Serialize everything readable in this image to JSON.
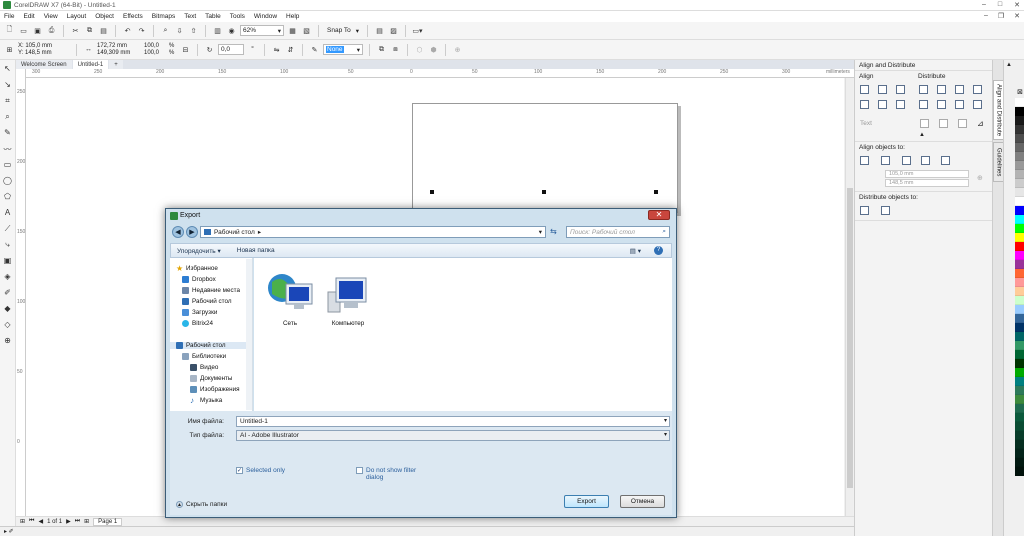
{
  "window": {
    "title": "CorelDRAW X7 (64-Bit) - Untitled-1",
    "min": "–",
    "max": "□",
    "close": "✕"
  },
  "menu": [
    "File",
    "Edit",
    "View",
    "Layout",
    "Object",
    "Effects",
    "Bitmaps",
    "Text",
    "Table",
    "Tools",
    "Window",
    "Help"
  ],
  "mdi_controls": {
    "min": "–",
    "restore": "❐",
    "close": "✕"
  },
  "toolbar1": {
    "zoom": "62%",
    "snap": "Snap To"
  },
  "toolbar2": {
    "x": "X: 105,0 mm",
    "y": "Y: 148,5 mm",
    "w": "172,72 mm",
    "h": "149,309 mm",
    "sx": "100,0",
    "sy": "100,0",
    "pct": "%",
    "angle": "0,0",
    "outline": "None"
  },
  "doc_tabs": [
    "Welcome Screen",
    "Untitled-1"
  ],
  "ruler": {
    "ticks": [
      "300",
      "250",
      "200",
      "150",
      "100",
      "50",
      "0",
      "50",
      "100",
      "150",
      "200",
      "250",
      "300",
      "350"
    ],
    "unit": "millimeters"
  },
  "vruler_ticks": [
    "250",
    "200",
    "150",
    "100",
    "50",
    "0"
  ],
  "bottom": {
    "page_count": "1 of 1",
    "page_tab": "Page 1"
  },
  "docker": {
    "title": "Align and Distribute",
    "align": "Align",
    "distribute": "Distribute",
    "text": "Text",
    "align_to": "Align objects to:",
    "x_val": "105,0 mm",
    "y_val": "148,5 mm",
    "distribute_to": "Distribute objects to:"
  },
  "vtabs": [
    "Align and Distribute",
    "Guidelines"
  ],
  "palette": [
    "#ffffff",
    "#000000",
    "#1a1a1a",
    "#333333",
    "#4d4d4d",
    "#666666",
    "#808080",
    "#999999",
    "#b3b3b3",
    "#cccccc",
    "#e6e6e6",
    "#ffffff",
    "#0000ff",
    "#00ffff",
    "#00ff00",
    "#ffff00",
    "#ff0000",
    "#ff00ff",
    "#993399",
    "#ff6633",
    "#ff9999",
    "#ffcc99",
    "#ccffcc",
    "#99ccff",
    "#336699",
    "#003366",
    "#006666",
    "#339966",
    "#006633",
    "#003300",
    "#00aa00",
    "#008080",
    "#2d7a5a",
    "#3d8a3d",
    "#1f6b4f",
    "#0b5a3c",
    "#0a4d33",
    "#083d2a",
    "#062e20",
    "#04241a",
    "#021a12",
    "#01120c"
  ],
  "dialog": {
    "title": "Export",
    "close": "✕",
    "back": "◀",
    "forward": "▶",
    "address": "Рабочий стол",
    "search_placeholder": "Поиск: Рабочий стол",
    "organize": "Упорядочить ▾",
    "new_folder": "Новая папка",
    "view_icon": "▤ ▾",
    "help_icon": "?",
    "nav": {
      "favorites": "Избранное",
      "dropbox": "Dropbox",
      "recent": "Недавние места",
      "desktop": "Рабочий стол",
      "downloads": "Загрузки",
      "bitrix": "Bitrix24",
      "desktop2": "Рабочий стол",
      "libraries": "Библиотеки",
      "video": "Видео",
      "documents": "Документы",
      "images": "Изображения",
      "music": "Музыка"
    },
    "files": [
      {
        "label": "Сеть"
      },
      {
        "label": "Компьютер"
      }
    ],
    "filename_label": "Имя файла:",
    "filename_value": "Untitled-1",
    "filetype_label": "Тип файла:",
    "filetype_value": "AI - Adobe Illustrator",
    "selected_only": "Selected only",
    "no_filter_line1": "Do not show filter",
    "no_filter_line2": "dialog",
    "hide_folders": "Скрыть папки",
    "export_btn": "Export",
    "cancel_btn": "Отмена"
  }
}
